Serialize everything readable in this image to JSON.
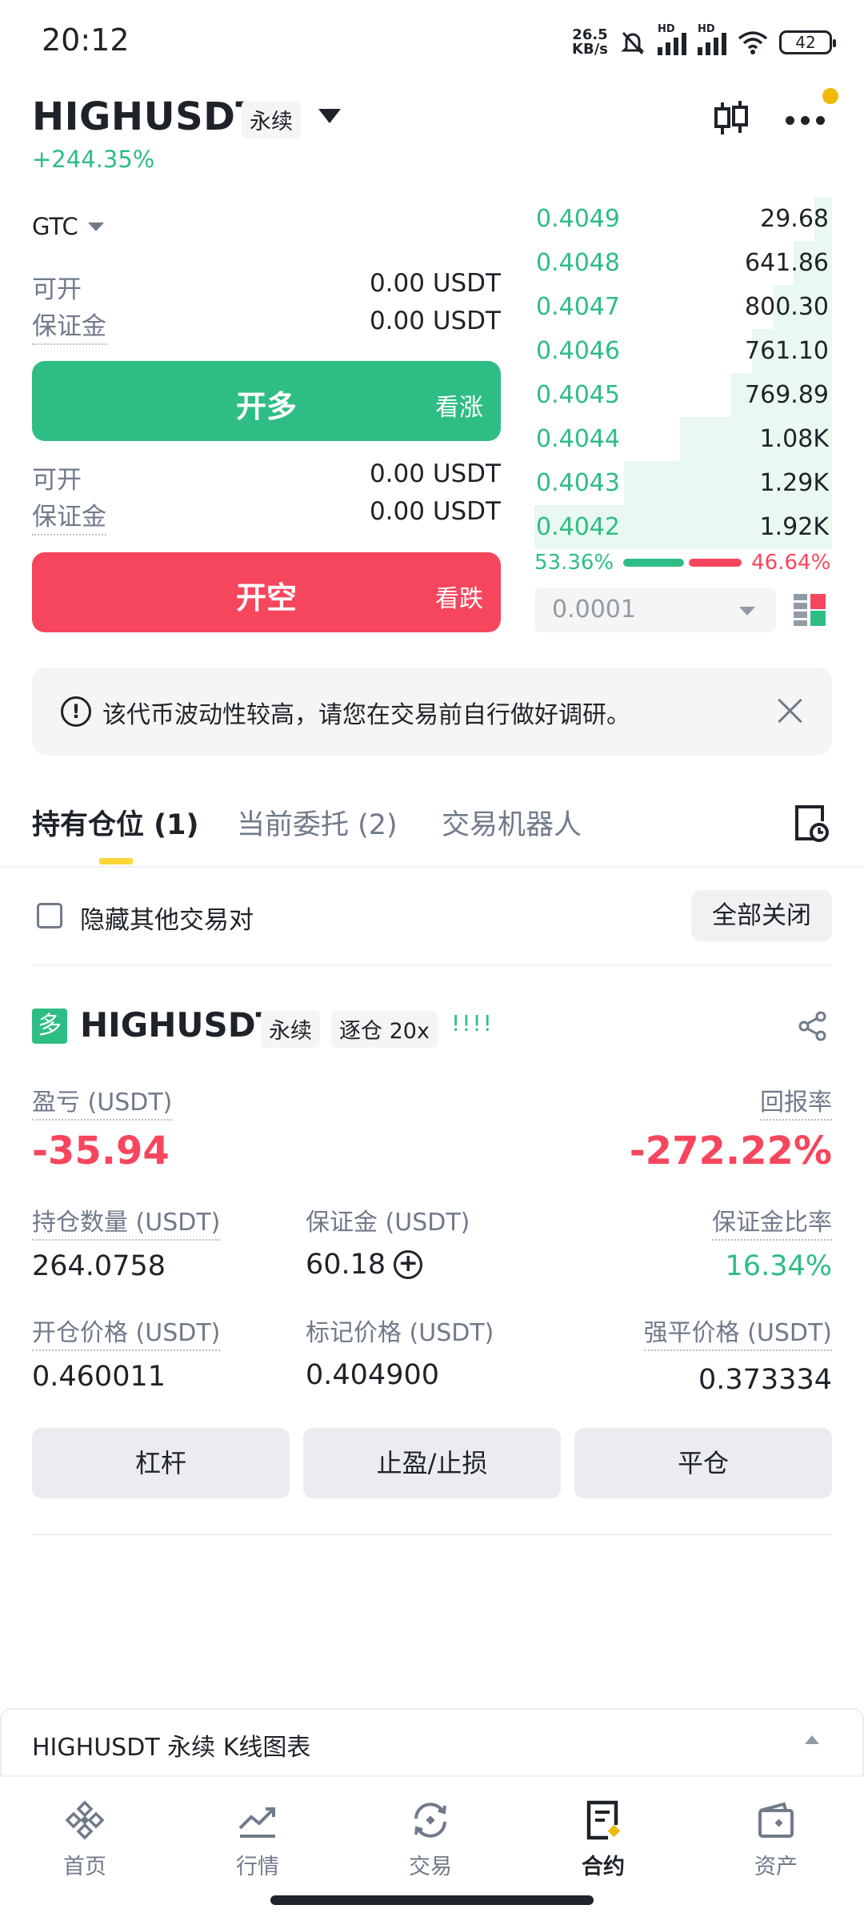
{
  "status_bar": {
    "time": "20:12",
    "net_speed_value": "26.5",
    "net_speed_unit": "KB/s",
    "sim_label": "HD",
    "battery": "42"
  },
  "header": {
    "symbol": "HIGHUSDT",
    "contract_type": "永续",
    "change_pct": "+244.35%"
  },
  "order_form": {
    "order_type": "GTC",
    "available_label": "可开",
    "margin_label": "保证金",
    "long": {
      "available": "0.00 USDT",
      "margin": "0.00 USDT",
      "button": "开多",
      "sub": "看涨"
    },
    "short": {
      "available": "0.00 USDT",
      "margin": "0.00 USDT",
      "button": "开空",
      "sub": "看跌"
    }
  },
  "orderbook": {
    "bids": [
      {
        "price": "0.4049",
        "qty": "29.68",
        "depth": 0.06
      },
      {
        "price": "0.4048",
        "qty": "641.86",
        "depth": 0.13
      },
      {
        "price": "0.4047",
        "qty": "800.30",
        "depth": 0.2
      },
      {
        "price": "0.4046",
        "qty": "761.10",
        "depth": 0.27
      },
      {
        "price": "0.4045",
        "qty": "769.89",
        "depth": 0.34
      },
      {
        "price": "0.4044",
        "qty": "1.08K",
        "depth": 0.51
      },
      {
        "price": "0.4043",
        "qty": "1.29K",
        "depth": 0.7
      },
      {
        "price": "0.4042",
        "qty": "1.92K",
        "depth": 1.0
      }
    ],
    "buy_ratio": "53.36%",
    "sell_ratio": "46.64%",
    "precision": "0.0001"
  },
  "notice": {
    "text": "该代币波动性较高，请您在交易前自行做好调研。"
  },
  "tabs": {
    "positions": "持有仓位 (1)",
    "orders": "当前委托 (2)",
    "bots": "交易机器人"
  },
  "filters": {
    "hide_other": "隐藏其他交易对",
    "close_all": "全部关闭"
  },
  "position": {
    "side": "多",
    "symbol": "HIGHUSDT",
    "contract_type": "永续",
    "margin_mode": "逐仓 20x",
    "signal": "!!!!",
    "pnl_label": "盈亏 (USDT)",
    "pnl": "-35.94",
    "roe_label": "回报率",
    "roe": "-272.22%",
    "size_label": "持仓数量 (USDT)",
    "size": "264.0758",
    "margin_label": "保证金 (USDT)",
    "margin": "60.18",
    "margin_ratio_label": "保证金比率",
    "margin_ratio": "16.34%",
    "entry_label": "开仓价格 (USDT)",
    "entry": "0.460011",
    "mark_label": "标记价格 (USDT)",
    "mark": "0.404900",
    "liq_label": "强平价格 (USDT)",
    "liq": "0.373334",
    "buttons": {
      "leverage": "杠杆",
      "tpsl": "止盈/止损",
      "close": "平仓"
    }
  },
  "kline_bar": {
    "text": "HIGHUSDT 永续 K线图表"
  },
  "nav": {
    "home": "首页",
    "markets": "行情",
    "trade": "交易",
    "futures": "合约",
    "assets": "资产"
  },
  "colors": {
    "green": "#2ebd85",
    "red": "#f6465d",
    "yellow": "#f0b90b",
    "text": "#1e2329"
  }
}
